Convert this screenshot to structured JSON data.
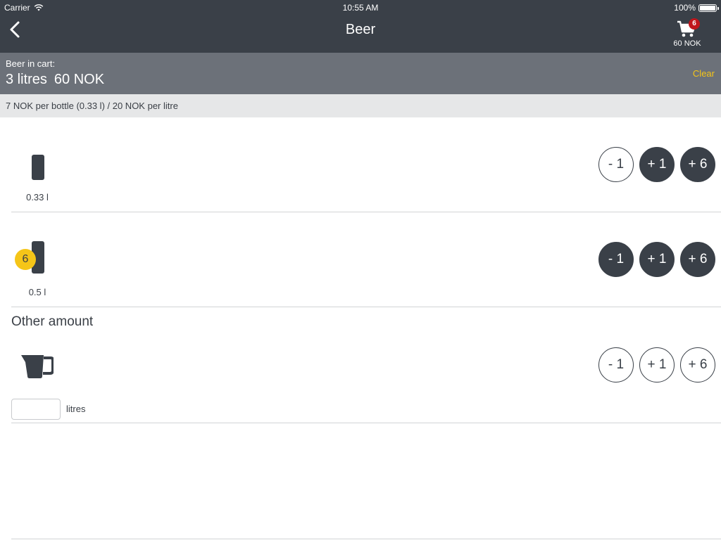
{
  "status": {
    "carrier": "Carrier",
    "time": "10:55 AM",
    "battery": "100%"
  },
  "nav": {
    "title": "Beer",
    "cart_count": "6",
    "cart_total": "60 NOK"
  },
  "summary": {
    "label": "Beer in cart:",
    "volume": "3 litres",
    "amount": "60 NOK",
    "clear_label": "Clear"
  },
  "price_info": "7 NOK per bottle (0.33 l) / 20 NOK per litre",
  "items": [
    {
      "size_label": "0.33 l",
      "quantity": null,
      "buttons": [
        "- 1",
        "+ 1",
        "+ 6"
      ]
    },
    {
      "size_label": "0.5 l",
      "quantity": "6",
      "buttons": [
        "- 1",
        "+ 1",
        "+ 6"
      ]
    }
  ],
  "other": {
    "title": "Other amount",
    "input_value": "",
    "unit_label": "litres",
    "buttons": [
      "- 1",
      "+ 1",
      "+ 6"
    ]
  },
  "colors": {
    "dark": "#3a4048",
    "summary_bg": "#6c7179",
    "accent_yellow": "#f5c518",
    "badge_red": "#c0161c",
    "price_bg": "#e6e7e8"
  },
  "icons": {
    "back": "chevron-left-icon",
    "cart": "shopping-cart-icon",
    "small_bottle": "can-icon",
    "large_bottle": "can-icon",
    "other": "measuring-jug-icon",
    "wifi": "wifi-icon",
    "battery": "battery-icon"
  }
}
